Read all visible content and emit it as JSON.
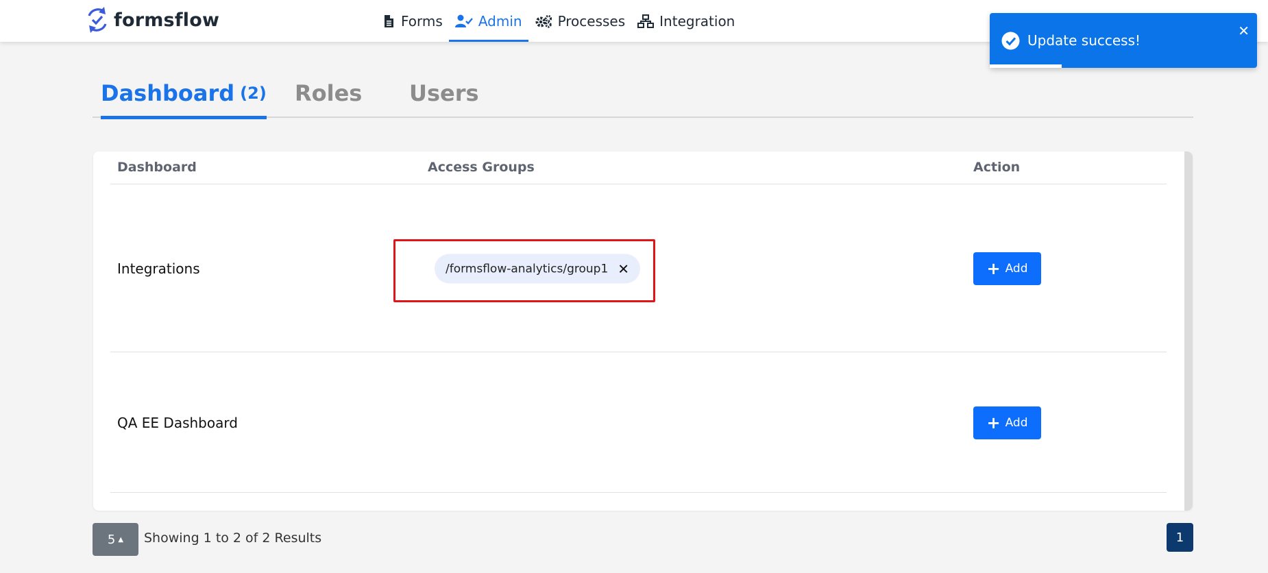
{
  "brand": {
    "name": "formsflow"
  },
  "nav": {
    "items": [
      {
        "label": "Forms",
        "icon": "file-icon",
        "active": false
      },
      {
        "label": "Admin",
        "icon": "user-check-icon",
        "active": true
      },
      {
        "label": "Processes",
        "icon": "cogs-icon",
        "active": false
      },
      {
        "label": "Integration",
        "icon": "sitemap-icon",
        "active": false
      }
    ]
  },
  "tabs": {
    "dashboard": {
      "label": "Dashboard",
      "count": "(2)"
    },
    "roles": {
      "label": "Roles"
    },
    "users": {
      "label": "Users"
    }
  },
  "table": {
    "headers": {
      "dashboard": "Dashboard",
      "access_groups": "Access Groups",
      "action": "Action"
    },
    "rows": [
      {
        "name": "Integrations",
        "groups": [
          "/formsflow-analytics/group1"
        ],
        "action_label": "Add"
      },
      {
        "name": "QA EE Dashboard",
        "groups": [],
        "action_label": "Add"
      }
    ]
  },
  "pagination": {
    "page_size": "5",
    "summary": "Showing 1 to 2 of 2 Results",
    "current_page": "1"
  },
  "toast": {
    "message": "Update success!",
    "close": "✕",
    "progress": 0.27
  },
  "colors": {
    "accent": "#1a73e8",
    "button": "#0d6efd",
    "toast": "#0a74e8",
    "highlight": "#e0151a"
  }
}
